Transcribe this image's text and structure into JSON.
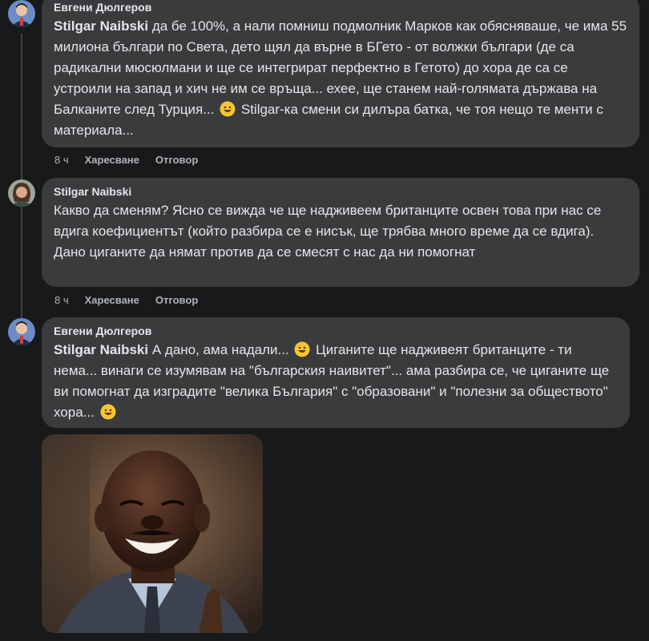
{
  "comments": [
    {
      "author": "Евгени Дюлгеров",
      "mention": "Stilgar Naibski",
      "text_before": " да бе 100%, а нали помниш подмолник Марков как обясняваше, че има 55 милиона българи по Света, дето щял да върне в БГето - от волжки българи (де са радикални мюсюлмани и ще се интегрират перфектно в Гетото) до хора де са се устроили на запад и хич не им се връща... ехее, ще станем най-голямата държава на Балканите след Турция...",
      "text_after": " Stilgar-ка смени си дилъра батка, че тоя нещо те менти с материала...",
      "time": "8 ч",
      "like": "Харесване",
      "reply": "Отговор"
    },
    {
      "author": "Stilgar Naibski",
      "text": "Какво да сменям? Ясно се вижда че ще надживеем британците освен това при нас се вдига коефициентът (който разбира се е нисък, ще трябва много време да се вдига). Дано циганите да нямат против да се смесят с нас да ни помогнат",
      "time": "8 ч",
      "like": "Харесване",
      "reply": "Отговор"
    },
    {
      "author": "Евгени Дюлгеров",
      "mention": "Stilgar Naibski",
      "text_part1": " А дано, ама надали...",
      "text_part2": " Циганите ще надживеят британците - ти нема... винаги се изумявам на \"българския наивитет\"... ама разбира се, че циганите ще ви помогнат да изградите \"велика България\" с \"образовани\" и \"полезни за обществото\" хора...",
      "image_alt": "laughing-man-gif"
    }
  ],
  "colors": {
    "background": "#18191a",
    "bubble": "#3a3b3c",
    "text": "#e4e6eb",
    "secondary_text": "#b0b3b8"
  }
}
